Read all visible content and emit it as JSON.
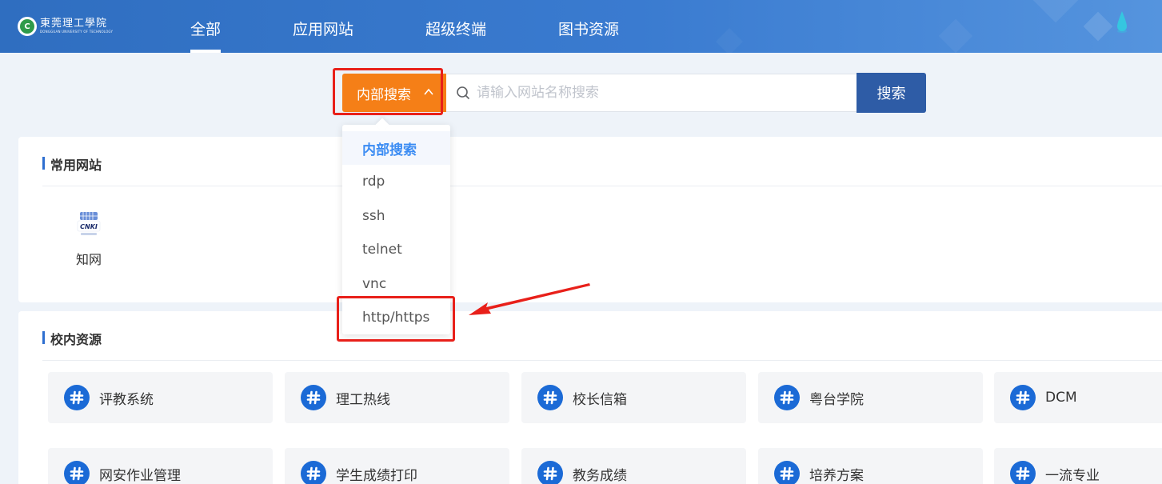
{
  "header": {
    "logo": {
      "cn": "東莞理工學院",
      "en": "DONGGUAN UNIVERSITY OF TECHNOLOGY"
    },
    "nav": [
      {
        "label": "全部",
        "active": true
      },
      {
        "label": "应用网站",
        "active": false
      },
      {
        "label": "超级终端",
        "active": false
      },
      {
        "label": "图书资源",
        "active": false
      }
    ]
  },
  "search": {
    "type_label": "内部搜索",
    "placeholder": "请输入网站名称搜索",
    "button_label": "搜索",
    "dropdown": [
      {
        "label": "内部搜索",
        "selected": true
      },
      {
        "label": "rdp",
        "selected": false
      },
      {
        "label": "ssh",
        "selected": false
      },
      {
        "label": "telnet",
        "selected": false
      },
      {
        "label": "vnc",
        "selected": false
      },
      {
        "label": "http/https",
        "selected": false
      }
    ]
  },
  "common_sites": {
    "title": "常用网站",
    "items": [
      {
        "label": "知网",
        "icon": "cnki-icon",
        "icon_text": "CNKI"
      }
    ]
  },
  "campus_resources": {
    "title": "校内资源",
    "items": [
      {
        "label": "评教系统",
        "icon": "hash-icon"
      },
      {
        "label": "理工热线",
        "icon": "hash-icon"
      },
      {
        "label": "校长信箱",
        "icon": "hash-icon"
      },
      {
        "label": "粤台学院",
        "icon": "hash-icon"
      },
      {
        "label": "DCM",
        "icon": "hash-icon"
      },
      {
        "label": "网安作业管理",
        "icon": "hash-icon"
      },
      {
        "label": "学生成绩打印",
        "icon": "hash-icon"
      },
      {
        "label": "教务成绩",
        "icon": "hash-icon"
      },
      {
        "label": "培养方案",
        "icon": "hash-icon"
      },
      {
        "label": "一流专业",
        "icon": "hash-icon"
      }
    ]
  },
  "colors": {
    "header": "#3a7bd0",
    "search_type": "#f57f17",
    "search_button": "#2e5ca6",
    "dropdown_selected": "#3b8cf3",
    "resource_icon": "#1b6ad6",
    "annotation": "#e8201a"
  }
}
